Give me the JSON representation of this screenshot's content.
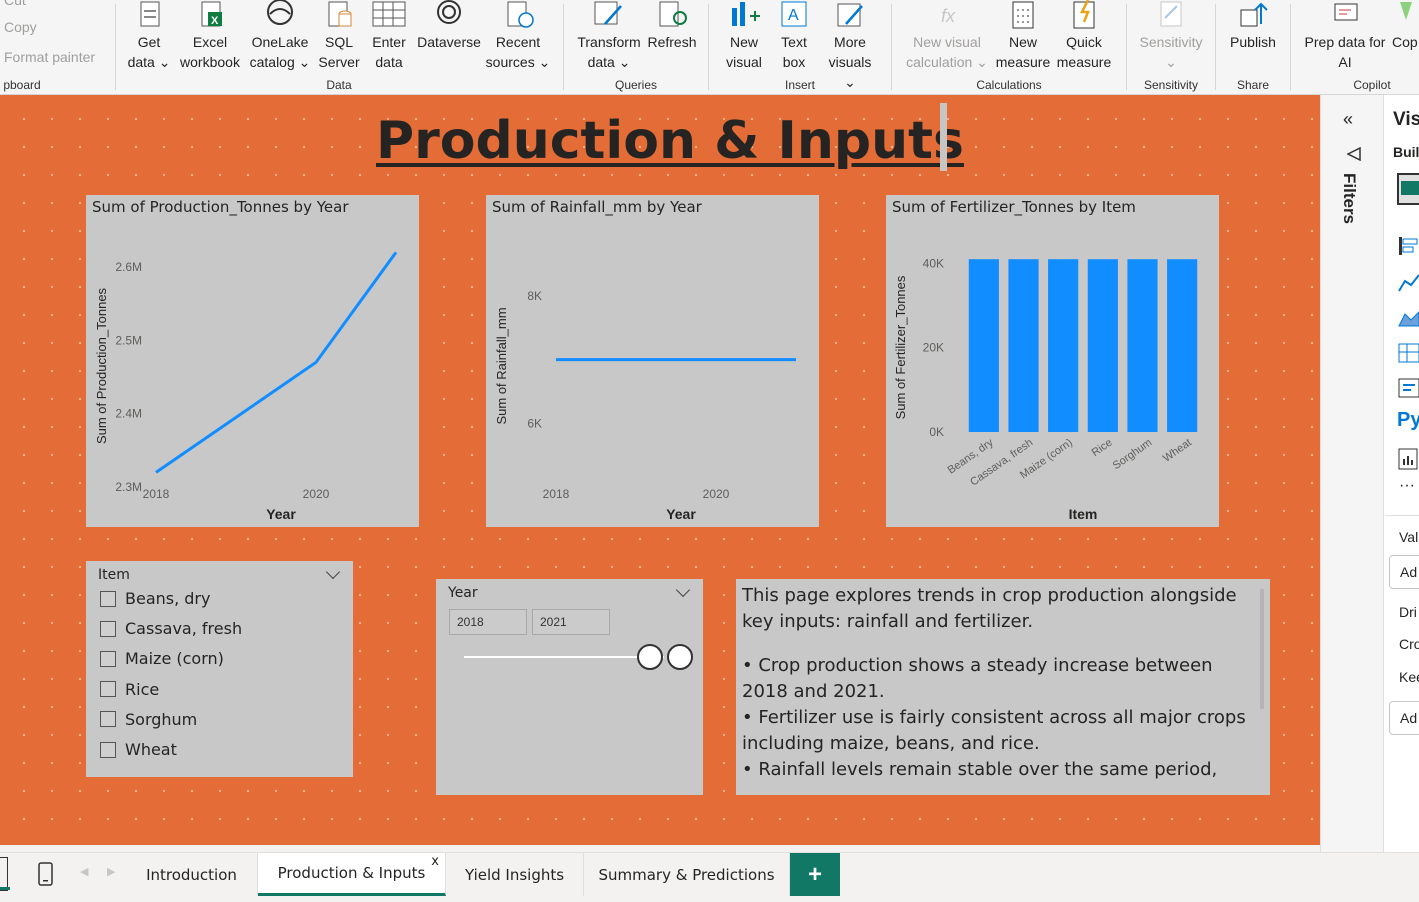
{
  "ribbon": {
    "clipboard": {
      "cut": "Cut",
      "copy": "Copy",
      "format_painter": "Format painter",
      "group": "pboard"
    },
    "data": {
      "get_data": "Get\ndata ⌄",
      "excel": "Excel\nworkbook",
      "onelake": "OneLake\ncatalog ⌄",
      "sql": "SQL\nServer",
      "enter": "Enter\ndata",
      "dataverse": "Dataverse",
      "recent": "Recent\nsources ⌄",
      "group": "Data"
    },
    "queries": {
      "transform": "Transform\ndata ⌄",
      "refresh": "Refresh",
      "group": "Queries"
    },
    "insert": {
      "new_visual": "New\nvisual",
      "text_box": "Text\nbox",
      "more_visuals": "More\nvisuals ⌄",
      "group": "Insert"
    },
    "calculations": {
      "new_visual_calc": "New visual\ncalculation ⌄",
      "new_measure": "New\nmeasure",
      "quick_measure": "Quick\nmeasure",
      "group": "Calculations"
    },
    "sensitivity": {
      "label": "Sensitivity\n⌄",
      "group": "Sensitivity"
    },
    "share": {
      "publish": "Publish",
      "group": "Share"
    },
    "copilot": {
      "prep": "Prep data for\nAI",
      "copilot": "Cop",
      "group": "Copilot"
    }
  },
  "report": {
    "title": "Production & Inputs"
  },
  "charts": {
    "production": {
      "title": "Sum of Production_Tonnes by Year"
    },
    "rainfall": {
      "title": "Sum of Rainfall_mm by Year"
    },
    "fertilizer": {
      "title": "Sum of Fertilizer_Tonnes by Item"
    }
  },
  "chart_data": [
    {
      "type": "line",
      "title": "Sum of Production_Tonnes by Year",
      "xlabel": "Year",
      "ylabel": "Sum of Production_Tonnes",
      "x": [
        2018,
        2020,
        2021
      ],
      "x_ticks": [
        "2018",
        "2020"
      ],
      "y_ticks": [
        "2.3M",
        "2.4M",
        "2.5M",
        "2.6M"
      ],
      "y_tick_values": [
        2300000,
        2400000,
        2500000,
        2600000
      ],
      "series": [
        {
          "values": [
            2320000,
            2470000,
            2620000
          ]
        }
      ],
      "xlim": [
        2017.9,
        2021.1
      ],
      "ylim": [
        2300000,
        2630000
      ],
      "color": "#118dff"
    },
    {
      "type": "line",
      "title": "Sum of Rainfall_mm by Year",
      "xlabel": "Year",
      "ylabel": "Sum of Rainfall_mm",
      "x": [
        2018,
        2021
      ],
      "x_ticks": [
        "2018",
        "2020"
      ],
      "y_ticks": [
        "6K",
        "8K"
      ],
      "y_tick_values": [
        6000,
        8000
      ],
      "series": [
        {
          "values": [
            7000,
            7000
          ]
        }
      ],
      "xlim": [
        2017.9,
        2021.1
      ],
      "ylim": [
        5000,
        8800
      ],
      "color": "#118dff"
    },
    {
      "type": "bar",
      "title": "Sum of Fertilizer_Tonnes by Item",
      "xlabel": "Item",
      "ylabel": "Sum of Fertilizer_Tonnes",
      "categories": [
        "Beans, dry",
        "Cassava, fresh",
        "Maize (corn)",
        "Rice",
        "Sorghum",
        "Wheat"
      ],
      "values": [
        41000,
        41000,
        41000,
        41000,
        41000,
        41000
      ],
      "y_ticks": [
        "0K",
        "20K",
        "40K"
      ],
      "y_tick_values": [
        0,
        20000,
        40000
      ],
      "ylim": [
        0,
        42000
      ],
      "color": "#118dff"
    }
  ],
  "item_slicer": {
    "title": "Item",
    "items": [
      "Beans, dry",
      "Cassava, fresh",
      "Maize (corn)",
      "Rice",
      "Sorghum",
      "Wheat"
    ]
  },
  "year_slicer": {
    "title": "Year",
    "start": "2018",
    "end": "2021"
  },
  "textbox": {
    "intro": "This page explores trends in crop production alongside key inputs: rainfall and fertilizer.",
    "b1": "• Crop production shows a steady increase between 2018 and 2021.",
    "b2": "• Fertilizer use is fairly consistent across all major crops including maize, beans, and rice.",
    "b3": "• Rainfall levels remain stable over the same period,"
  },
  "right_pane": {
    "filters": "Filters",
    "visualizations": "Vis",
    "build": "Buil",
    "py": "Py",
    "values": "Val",
    "add1": "Ad",
    "drill": "Dri",
    "cross": "Cro",
    "keep": "Kee",
    "add2": "Ad"
  },
  "tabs": [
    "Introduction",
    "Production & Inputs",
    "Yield Insights",
    "Summary & Predictions"
  ],
  "tab_close": "x",
  "add_tab": "+"
}
